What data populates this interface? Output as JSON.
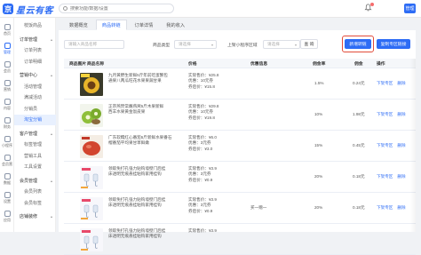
{
  "app": {
    "logo_glyph": "京",
    "name": "星云有客"
  },
  "topbar": {
    "search_placeholder": "搜索功能/数据/设置",
    "avatar_text": "管理"
  },
  "rail": [
    {
      "label": "首页",
      "icon": "home-icon",
      "active": false
    },
    {
      "label": "管理",
      "icon": "shop-icon",
      "active": true
    },
    {
      "label": "会员",
      "icon": "user-icon",
      "active": false
    },
    {
      "label": "营销",
      "icon": "gift-icon",
      "active": false
    },
    {
      "label": "内容",
      "icon": "file-icon",
      "active": false
    },
    {
      "label": "财务",
      "icon": "wallet-icon",
      "active": false
    },
    {
      "label": "小程序",
      "icon": "app-icon",
      "active": false
    },
    {
      "label": "会员营",
      "icon": "crown-icon",
      "active": false
    },
    {
      "label": "数据",
      "icon": "chart-icon",
      "active": false
    },
    {
      "label": "设置",
      "icon": "gear-icon",
      "active": false
    },
    {
      "label": "应用",
      "icon": "grid-icon",
      "active": false
    }
  ],
  "sidebar": {
    "top_item": "枝饭商品",
    "groups": [
      {
        "title": "订单管理",
        "items": [
          "订单列表",
          "订单明细"
        ]
      },
      {
        "title": "营销中心",
        "items": [
          "活动管理",
          "满减活动",
          "分销员",
          "淘宝分销"
        ]
      },
      {
        "title": "客户管理",
        "items": [
          "标签管理",
          "营销工具",
          "工具设置"
        ]
      },
      {
        "title": "会员管理",
        "items": [
          "会员列表",
          "会员标签"
        ]
      },
      {
        "title": "店铺装修",
        "items": []
      }
    ],
    "active_item": "淘宝分销"
  },
  "tabs": [
    {
      "label": "数据概览",
      "active": false
    },
    {
      "label": "商品转链",
      "active": true
    },
    {
      "label": "订单详情",
      "active": false
    },
    {
      "label": "我的收入",
      "active": false
    }
  ],
  "filters": {
    "keyword_placeholder": "请输入商品名称",
    "type_label": "商品类型",
    "type_placeholder": "请选择",
    "area_label": "上架小程序区域",
    "area_placeholder": "请选择",
    "search_button": "查 询",
    "add_button": "新增转链",
    "copy_button": "复制专区链接"
  },
  "table": {
    "columns": [
      "商品图片",
      "商品名称",
      "价格",
      "优惠信息",
      "佣金率",
      "佣金",
      "操作"
    ],
    "rows": [
      {
        "name": [
          "九月黄野生新鲜5斤年前吃蛋蟹包",
          "通果八两瓜旺花水果果蔬甘果"
        ],
        "price": [
          "实际售价：¥25.8",
          "优惠：10元券",
          "券后价：¥15.8"
        ],
        "discount": "",
        "rate": "1.5%",
        "commission": "0.24元",
        "ops": [
          "下架专区",
          "删除"
        ],
        "thumb": "sunflower"
      },
      {
        "name": [
          "正宗燕赞常蘸燕窝5斤木果新鲜",
          "西羊水果黄金饭皮果"
        ],
        "price": [
          "实际售价：¥29.8",
          "优惠：10元券",
          "券后价：¥19.8"
        ],
        "discount": "",
        "rate": "10%",
        "commission": "1.98元",
        "ops": [
          "下架专区",
          "删除"
        ],
        "thumb": "kiwi"
      },
      {
        "name": [
          "广东软糯红心番茄5斤新鲜水果番石",
          "榴番茄平均果甘草鲜嫩"
        ],
        "price": [
          "实际售价：¥6.0",
          "优惠：3元券",
          "券后价：¥3.0"
        ],
        "discount": "",
        "rate": "15%",
        "commission": "0.45元",
        "ops": [
          "下架专区",
          "删除"
        ],
        "thumb": "tomato"
      },
      {
        "name": [
          "领取免打孔强力贴钩墙壁门后挂",
          "床透明无痕悬挂粘钩家用挂钩"
        ],
        "price": [
          "实际售价：¥3.9",
          "优惠：3元券",
          "券后价：¥0.9"
        ],
        "discount": "",
        "rate": "20%",
        "commission": "0.18元",
        "ops": [
          "下架专区",
          "删除"
        ],
        "thumb": "hook"
      },
      {
        "name": [
          "领取免打孔强力贴钩墙壁门后挂",
          "床透明无痕悬挂粘钩家用挂钩"
        ],
        "price": [
          "实际售价：¥3.9",
          "优惠：3元券",
          "券后价：¥0.9"
        ],
        "discount": "买一赠一",
        "rate": "20%",
        "commission": "0.18元",
        "ops": [
          "下架专区",
          "删除"
        ],
        "thumb": "hook"
      },
      {
        "name": [
          "领取免打孔强力贴钩墙壁门后挂",
          "床透明无痕悬挂粘钩家用挂钩"
        ],
        "price": [
          "实际售价：¥3.9"
        ],
        "discount": "",
        "rate": "",
        "commission": "",
        "ops": [],
        "thumb": "hook"
      }
    ]
  },
  "colors": {
    "primary": "#2d6cf5",
    "highlight": "#e24c3a"
  }
}
